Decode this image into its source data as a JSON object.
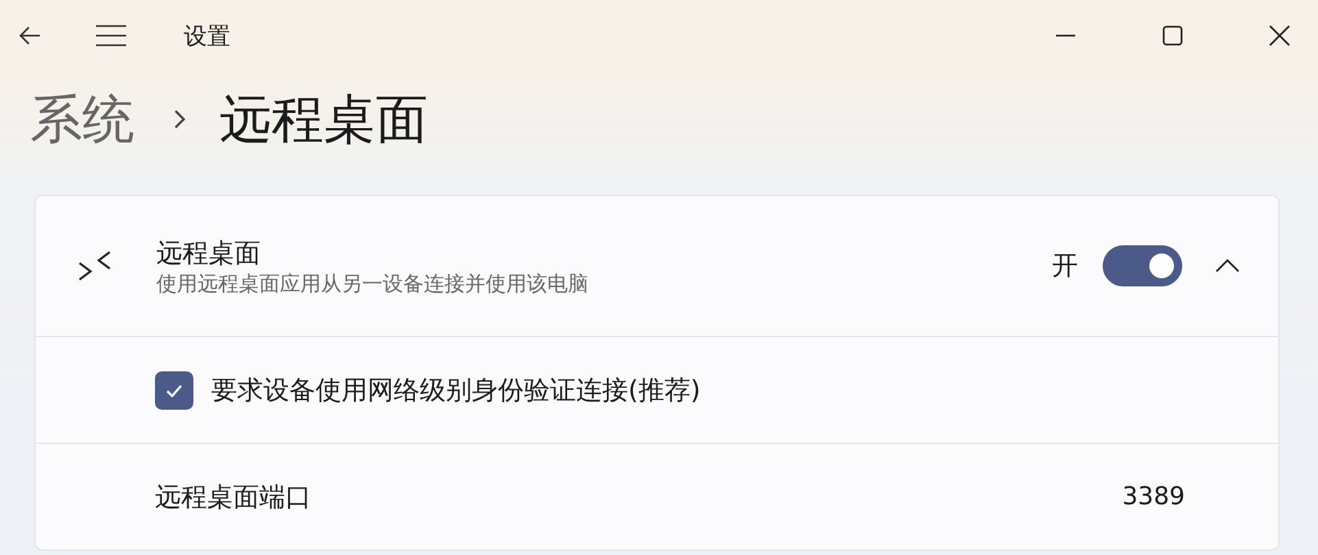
{
  "window": {
    "title": "设置"
  },
  "breadcrumb": [
    {
      "label": "系统",
      "selected": false
    },
    {
      "label": "远程桌面",
      "selected": true
    }
  ],
  "remote_desktop": {
    "title": "远程桌面",
    "description": "使用远程桌面应用从另一设备连接并使用该电脑",
    "state_label": "开",
    "on": true,
    "expanded": true
  },
  "nla": {
    "label": "要求设备使用网络级别身份验证连接(推荐)",
    "checked": true
  },
  "port": {
    "label": "远程桌面端口",
    "value": "3389"
  }
}
